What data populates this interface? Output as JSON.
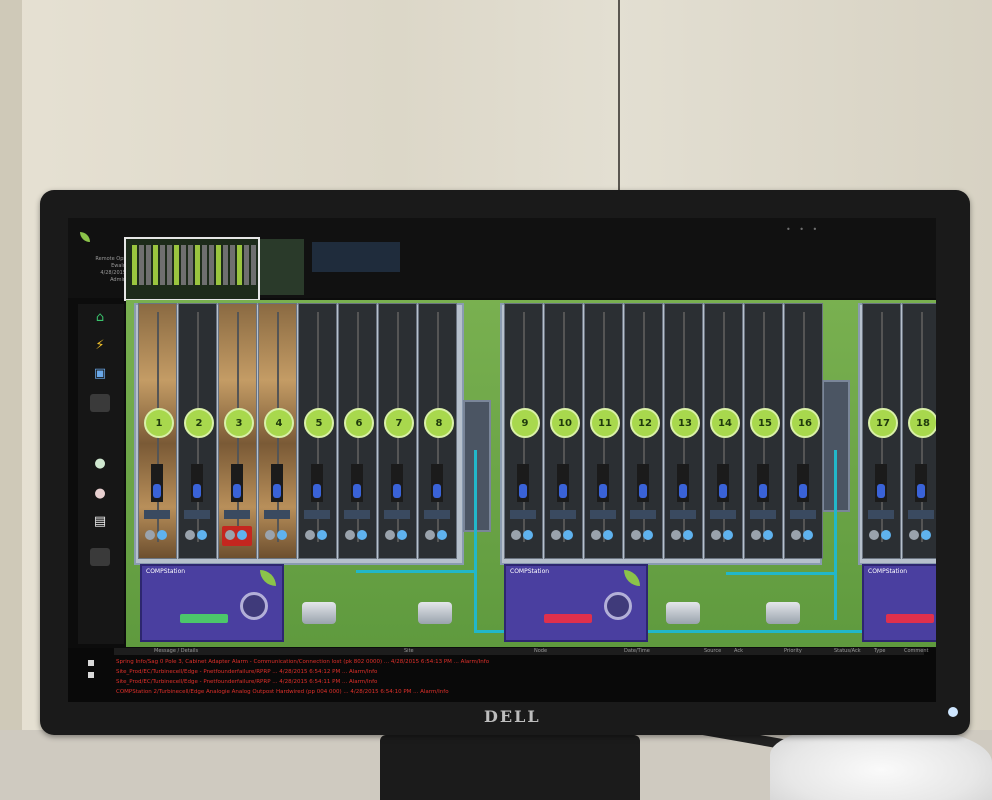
{
  "monitor": {
    "brand": "DELL"
  },
  "app": {
    "logo_text": "",
    "user_lines": [
      "Remote Ops",
      "Ewald",
      "4/28/2015",
      "Admin"
    ],
    "window_controls": "• • •"
  },
  "sidebar": {
    "items": [
      {
        "name": "home-icon",
        "glyph": "⌂",
        "color": "#39c26b"
      },
      {
        "name": "lightning-icon",
        "glyph": "⚡",
        "color": "#f3c22b"
      },
      {
        "name": "monitor-icon",
        "glyph": "▣",
        "color": "#6aa8e8"
      },
      {
        "name": "blank-icon",
        "glyph": "",
        "color": "#3a3a3a"
      },
      {
        "name": "user-add-icon",
        "glyph": "●",
        "color": "#cfe7cf"
      },
      {
        "name": "user-remove-icon",
        "glyph": "●",
        "color": "#e7cfcf"
      },
      {
        "name": "document-icon",
        "glyph": "▤",
        "color": "#eeeeee"
      },
      {
        "name": "blank-icon",
        "glyph": "",
        "color": "#3a3a3a"
      }
    ]
  },
  "channels": [
    {
      "label": "1",
      "wood": true
    },
    {
      "label": "2",
      "wood": false
    },
    {
      "label": "3",
      "wood": true,
      "alarm": true
    },
    {
      "label": "4",
      "wood": true
    },
    {
      "label": "5",
      "wood": false
    },
    {
      "label": "6",
      "wood": false
    },
    {
      "label": "7",
      "wood": false
    },
    {
      "label": "8",
      "wood": false
    },
    {
      "label": "9",
      "wood": false
    },
    {
      "label": "10",
      "wood": false
    },
    {
      "label": "11",
      "wood": false
    },
    {
      "label": "12",
      "wood": false
    },
    {
      "label": "13",
      "wood": false
    },
    {
      "label": "14",
      "wood": false
    },
    {
      "label": "15",
      "wood": false
    },
    {
      "label": "16",
      "wood": false
    },
    {
      "label": "17",
      "wood": false
    },
    {
      "label": "18",
      "wood": false
    }
  ],
  "modules": [
    {
      "title": "COMPStation",
      "bar_color": "#4cc76a"
    },
    {
      "title": "COMPStation",
      "bar_color": "#e0304c"
    },
    {
      "title": "COMPStation",
      "bar_color": "#e0304c"
    }
  ],
  "log": {
    "columns": [
      "Message / Details",
      "Site",
      "Node",
      "Date/Time",
      "Source",
      "Ack",
      "Priority",
      "Status/Ack",
      "Type",
      "Comment"
    ],
    "rows": [
      "Spring Info/Sag 0 Pole 3, Cabinet Adapter Alarm - Communication/Connection lost (pk 802 0000) ... 4/28/2015 6:54:13 PM ... Alarm/Info",
      "Site_Prod/EC/Turbinecell/Edge - Pnetfounderfailure/RPRP ... 4/28/2015 6:54:12 PM ... Alarm/Info",
      "Site_Prod/EC/Turbinecell/Edge - Pnetfounderfailure/RPRP ... 4/28/2015 6:54:11 PM ... Alarm/Info",
      "COMPStation 2/Turbinecell/Edge Analogie Analog Outpost Hardwired (pp 004 000) ... 4/28/2015 6:54:10 PM ... Alarm/Info"
    ]
  }
}
